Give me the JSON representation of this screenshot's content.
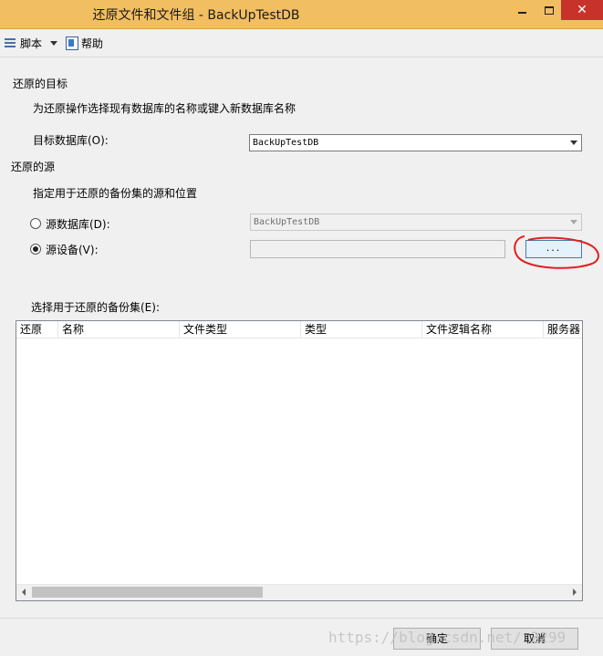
{
  "window": {
    "title": "还原文件和文件组 - BackUpTestDB",
    "close_glyph": "✕"
  },
  "toolbar": {
    "script_label": "脚本",
    "help_label": "帮助"
  },
  "target": {
    "section_title": "还原的目标",
    "description": "为还原操作选择现有数据库的名称或键入新数据库名称",
    "db_label": "目标数据库(O):",
    "db_value": "BackUpTestDB"
  },
  "source": {
    "section_title": "还原的源",
    "description": "指定用于还原的备份集的源和位置",
    "db_radio_label": "源数据库(D):",
    "db_value": "BackUpTestDB",
    "device_radio_label": "源设备(V):",
    "device_value": "",
    "browse_label": "...",
    "selected": "device"
  },
  "backup_sets": {
    "label": "选择用于还原的备份集(E):",
    "columns": [
      "还原",
      "名称",
      "文件类型",
      "类型",
      "文件逻辑名称",
      "服务器"
    ],
    "rows": []
  },
  "footer": {
    "ok_label": "确定",
    "cancel_label": "取消"
  },
  "watermark": "https://blog.csdn.net/    2299",
  "colors": {
    "titlebar": "#f2be62",
    "close_button": "#c7332b",
    "annotation": "#e02020"
  }
}
